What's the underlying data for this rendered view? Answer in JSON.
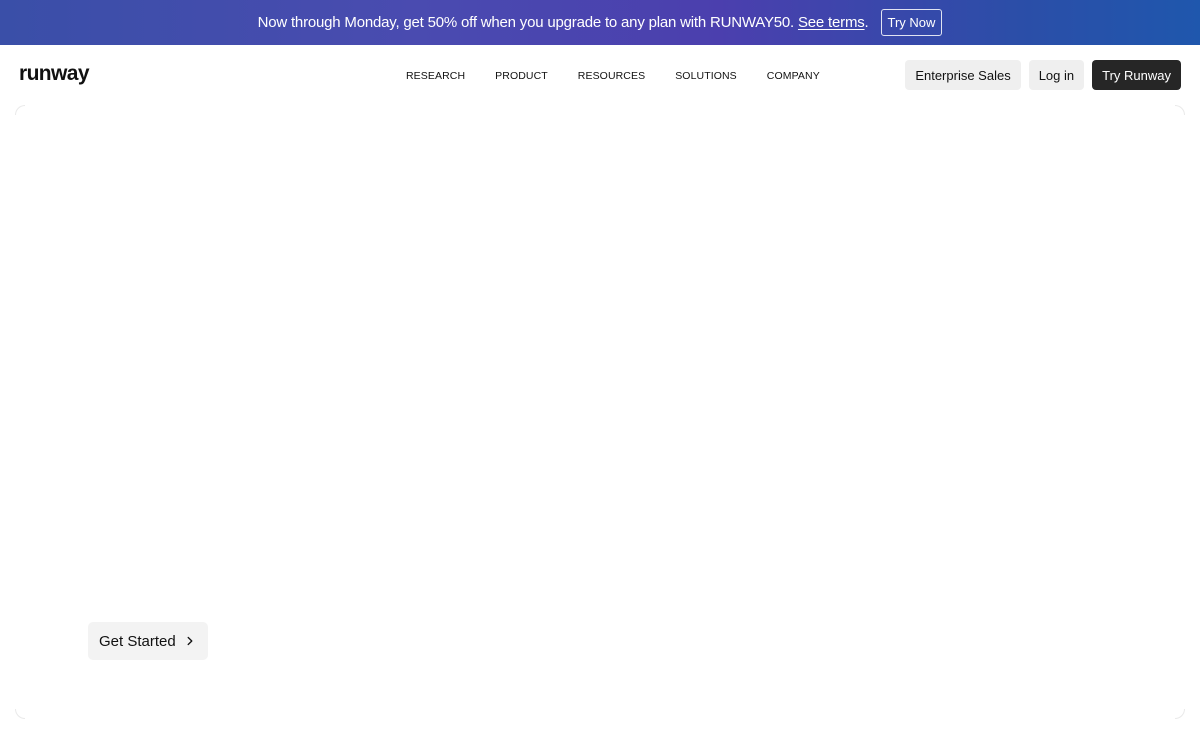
{
  "promo": {
    "text": "Now through Monday, get 50% off when you upgrade to any plan with RUNWAY50.",
    "link_label": "See terms",
    "period": ".",
    "button_label": "Try Now"
  },
  "header": {
    "logo": "runway",
    "nav": [
      {
        "label": "RESEARCH"
      },
      {
        "label": "PRODUCT"
      },
      {
        "label": "RESOURCES"
      },
      {
        "label": "SOLUTIONS"
      },
      {
        "label": "COMPANY"
      }
    ],
    "enterprise_label": "Enterprise Sales",
    "login_label": "Log in",
    "try_label": "Try Runway"
  },
  "hero": {
    "cta_label": "Get Started",
    "cta_icon": "chevron-right-icon"
  },
  "colors": {
    "banner_gradient_start": "#3a4fa8",
    "banner_gradient_end": "#1f57ad",
    "primary_button": "#262626",
    "secondary_button": "#efefef"
  }
}
